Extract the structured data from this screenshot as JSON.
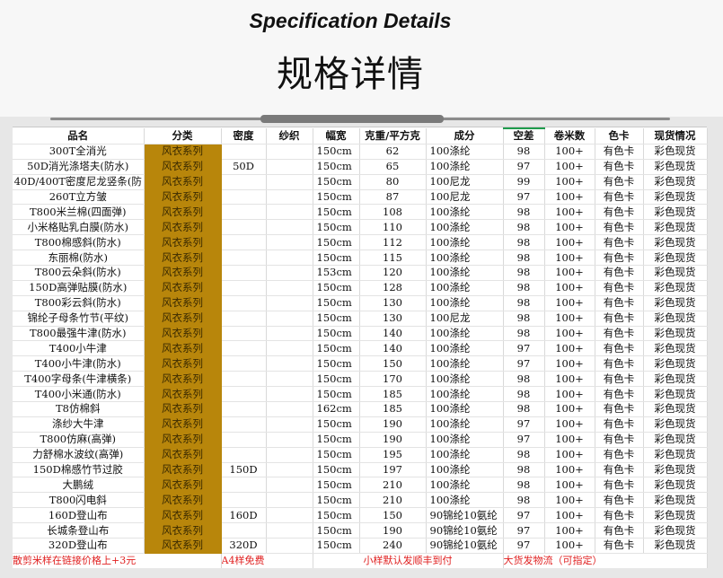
{
  "header": {
    "title_en": "Specification Details",
    "title_cn": "规格详情"
  },
  "colors": {
    "category_fill": "#b8860b",
    "footer_text": "#e02020",
    "header_highlight": "#1f9c4d"
  },
  "table": {
    "columns": [
      "品名",
      "分类",
      "密度",
      "纱织",
      "幅宽",
      "克重/平方克",
      "成分",
      "空差",
      "卷米数",
      "色卡",
      "现货情况"
    ],
    "rows": [
      [
        "300T全消光",
        "风衣系列",
        "",
        "",
        "150cm",
        "62",
        "100涤纶",
        "98",
        "100+",
        "有色卡",
        "彩色现货"
      ],
      [
        "50D消光涤塔夫(防水)",
        "风衣系列",
        "50D",
        "",
        "150cm",
        "65",
        "100涤纶",
        "97",
        "100+",
        "有色卡",
        "彩色现货"
      ],
      [
        "40D/400T密度尼龙竖条(防",
        "风衣系列",
        "",
        "",
        "150cm",
        "80",
        "100尼龙",
        "99",
        "100+",
        "有色卡",
        "彩色现货"
      ],
      [
        "260T立方皱",
        "风衣系列",
        "",
        "",
        "150cm",
        "87",
        "100尼龙",
        "97",
        "100+",
        "有色卡",
        "彩色现货"
      ],
      [
        "T800米兰棉(四面弹)",
        "风衣系列",
        "",
        "",
        "150cm",
        "108",
        "100涤纶",
        "98",
        "100+",
        "有色卡",
        "彩色现货"
      ],
      [
        "小米格贴乳白膜(防水)",
        "风衣系列",
        "",
        "",
        "150cm",
        "110",
        "100涤纶",
        "98",
        "100+",
        "有色卡",
        "彩色现货"
      ],
      [
        "T800棉感斜(防水)",
        "风衣系列",
        "",
        "",
        "150cm",
        "112",
        "100涤纶",
        "98",
        "100+",
        "有色卡",
        "彩色现货"
      ],
      [
        "东丽棉(防水)",
        "风衣系列",
        "",
        "",
        "150cm",
        "115",
        "100涤纶",
        "98",
        "100+",
        "有色卡",
        "彩色现货"
      ],
      [
        "T800云朵斜(防水)",
        "风衣系列",
        "",
        "",
        "153cm",
        "120",
        "100涤纶",
        "98",
        "100+",
        "有色卡",
        "彩色现货"
      ],
      [
        "150D高弹贴膜(防水)",
        "风衣系列",
        "",
        "",
        "150cm",
        "128",
        "100涤纶",
        "98",
        "100+",
        "有色卡",
        "彩色现货"
      ],
      [
        "T800彩云斜(防水)",
        "风衣系列",
        "",
        "",
        "150cm",
        "130",
        "100涤纶",
        "98",
        "100+",
        "有色卡",
        "彩色现货"
      ],
      [
        "锦纶子母条竹节(平纹)",
        "风衣系列",
        "",
        "",
        "150cm",
        "130",
        "100尼龙",
        "98",
        "100+",
        "有色卡",
        "彩色现货"
      ],
      [
        "T800最强牛津(防水)",
        "风衣系列",
        "",
        "",
        "150cm",
        "140",
        "100涤纶",
        "98",
        "100+",
        "有色卡",
        "彩色现货"
      ],
      [
        "T400小牛津",
        "风衣系列",
        "",
        "",
        "150cm",
        "140",
        "100涤纶",
        "97",
        "100+",
        "有色卡",
        "彩色现货"
      ],
      [
        "T400小牛津(防水)",
        "风衣系列",
        "",
        "",
        "150cm",
        "150",
        "100涤纶",
        "97",
        "100+",
        "有色卡",
        "彩色现货"
      ],
      [
        "T400字母条(牛津横条)",
        "风衣系列",
        "",
        "",
        "150cm",
        "170",
        "100涤纶",
        "98",
        "100+",
        "有色卡",
        "彩色现货"
      ],
      [
        "T400小米通(防水)",
        "风衣系列",
        "",
        "",
        "150cm",
        "185",
        "100涤纶",
        "98",
        "100+",
        "有色卡",
        "彩色现货"
      ],
      [
        "T8仿棉斜",
        "风衣系列",
        "",
        "",
        "162cm",
        "185",
        "100涤纶",
        "98",
        "100+",
        "有色卡",
        "彩色现货"
      ],
      [
        "涤纱大牛津",
        "风衣系列",
        "",
        "",
        "150cm",
        "190",
        "100涤纶",
        "97",
        "100+",
        "有色卡",
        "彩色现货"
      ],
      [
        "T800仿麻(高弹)",
        "风衣系列",
        "",
        "",
        "150cm",
        "190",
        "100涤纶",
        "97",
        "100+",
        "有色卡",
        "彩色现货"
      ],
      [
        "力舒棉水波纹(高弹)",
        "风衣系列",
        "",
        "",
        "150cm",
        "195",
        "100涤纶",
        "98",
        "100+",
        "有色卡",
        "彩色现货"
      ],
      [
        "150D棉感竹节过胶",
        "风衣系列",
        "150D",
        "",
        "150cm",
        "197",
        "100涤纶",
        "98",
        "100+",
        "有色卡",
        "彩色现货"
      ],
      [
        "大鹏绒",
        "风衣系列",
        "",
        "",
        "150cm",
        "210",
        "100涤纶",
        "98",
        "100+",
        "有色卡",
        "彩色现货"
      ],
      [
        "T800闪电斜",
        "风衣系列",
        "",
        "",
        "150cm",
        "210",
        "100涤纶",
        "98",
        "100+",
        "有色卡",
        "彩色现货"
      ],
      [
        "160D登山布",
        "风衣系列",
        "160D",
        "",
        "150cm",
        "150",
        "90锦纶10氨纶",
        "97",
        "100+",
        "有色卡",
        "彩色现货"
      ],
      [
        "长城条登山布",
        "风衣系列",
        "",
        "",
        "150cm",
        "190",
        "90锦纶10氨纶",
        "97",
        "100+",
        "有色卡",
        "彩色现货"
      ],
      [
        "320D登山布",
        "风衣系列",
        "320D",
        "",
        "150cm",
        "240",
        "90锦纶10氨纶",
        "97",
        "100+",
        "有色卡",
        "彩色现货"
      ]
    ],
    "footer": {
      "note_price": "散剪米样在链接价格上+3元",
      "note_a4": "A4样免费",
      "note_shipping": "小样默认发顺丰到付",
      "note_freight": "大货发物流（可指定）"
    }
  }
}
